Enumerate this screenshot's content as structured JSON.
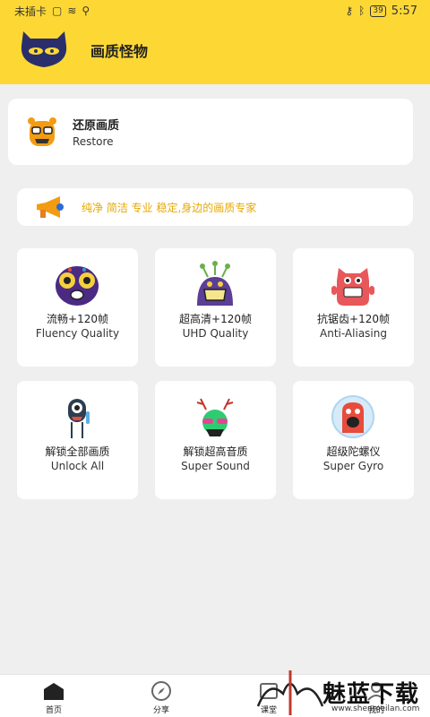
{
  "status_bar": {
    "carrier": "未插卡",
    "time": "5:57",
    "battery": "39"
  },
  "header": {
    "title": "画质怪物"
  },
  "restore": {
    "title_zh": "还原画质",
    "title_en": "Restore"
  },
  "banner": {
    "text": "纯净 简洁 专业 稳定,身边的画质专家"
  },
  "features": [
    {
      "zh": "流畅+120帧",
      "en": "Fluency Quality"
    },
    {
      "zh": "超高清+120帧",
      "en": "UHD Quality"
    },
    {
      "zh": "抗锯齿+120帧",
      "en": "Anti-Aliasing"
    },
    {
      "zh": "解锁全部画质",
      "en": "Unlock All"
    },
    {
      "zh": "解锁超高音质",
      "en": "Super Sound"
    },
    {
      "zh": "超级陀螺仪",
      "en": "Super Gyro"
    }
  ],
  "tabs": [
    {
      "label": "首页"
    },
    {
      "label": "分享"
    },
    {
      "label": "课堂"
    },
    {
      "label": "我的"
    }
  ],
  "watermark": {
    "text": "魅蓝下载",
    "url": "www.shenmeilan.com"
  },
  "colors": {
    "accent": "#fdd835",
    "banner_text": "#e6a800"
  }
}
